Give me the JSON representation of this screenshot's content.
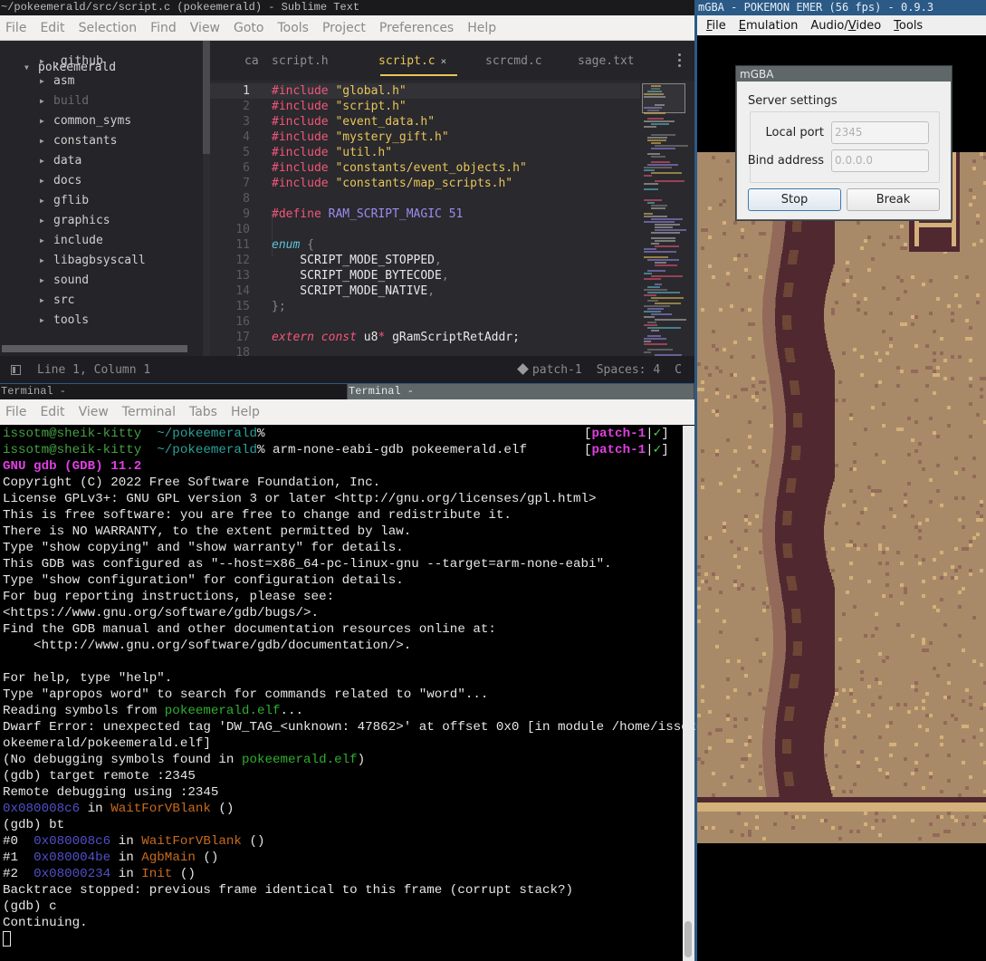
{
  "sublime": {
    "title": "~/pokeemerald/src/script.c (pokeemerald) - Sublime Text",
    "menu": [
      "File",
      "Edit",
      "Selection",
      "Find",
      "View",
      "Goto",
      "Tools",
      "Project",
      "Preferences",
      "Help"
    ],
    "sidebar": {
      "root": "pokeemerald",
      "items": [
        {
          "label": ".github",
          "dim": false
        },
        {
          "label": "asm",
          "dim": false
        },
        {
          "label": "build",
          "dim": true
        },
        {
          "label": "common_syms",
          "dim": false
        },
        {
          "label": "constants",
          "dim": false
        },
        {
          "label": "data",
          "dim": false
        },
        {
          "label": "docs",
          "dim": false
        },
        {
          "label": "gflib",
          "dim": false
        },
        {
          "label": "graphics",
          "dim": false
        },
        {
          "label": "include",
          "dim": false
        },
        {
          "label": "libagbsyscall",
          "dim": false
        },
        {
          "label": "sound",
          "dim": false
        },
        {
          "label": "src",
          "dim": false
        },
        {
          "label": "tools",
          "dim": false
        }
      ]
    },
    "tabs": [
      {
        "label": "ca",
        "active": false
      },
      {
        "label": "script.h",
        "active": false
      },
      {
        "label": "script.c",
        "active": true,
        "close": "×"
      },
      {
        "label": "scrcmd.c",
        "active": false
      },
      {
        "label": "sage.txt",
        "active": false
      }
    ],
    "code": [
      [
        [
          "kw",
          "#include"
        ],
        [
          "pl",
          " "
        ],
        [
          "str",
          "\"global.h\""
        ]
      ],
      [
        [
          "kw",
          "#include"
        ],
        [
          "pl",
          " "
        ],
        [
          "str",
          "\"script.h\""
        ]
      ],
      [
        [
          "kw",
          "#include"
        ],
        [
          "pl",
          " "
        ],
        [
          "str",
          "\"event_data.h\""
        ]
      ],
      [
        [
          "kw",
          "#include"
        ],
        [
          "pl",
          " "
        ],
        [
          "str",
          "\"mystery_gift.h\""
        ]
      ],
      [
        [
          "kw",
          "#include"
        ],
        [
          "pl",
          " "
        ],
        [
          "str",
          "\"util.h\""
        ]
      ],
      [
        [
          "kw",
          "#include"
        ],
        [
          "pl",
          " "
        ],
        [
          "str",
          "\"constants/event_objects.h\""
        ]
      ],
      [
        [
          "kw",
          "#include"
        ],
        [
          "pl",
          " "
        ],
        [
          "str",
          "\"constants/map_scripts.h\""
        ]
      ],
      [],
      [
        [
          "kw",
          "#define"
        ],
        [
          "pl",
          " "
        ],
        [
          "mac",
          "RAM_SCRIPT_MAGIC"
        ],
        [
          "pl",
          " "
        ],
        [
          "num",
          "51"
        ]
      ],
      [],
      [
        [
          "enm",
          "enum"
        ],
        [
          "pl",
          " "
        ],
        [
          "pn",
          "{"
        ]
      ],
      [
        [
          "pl",
          "    SCRIPT_MODE_STOPPED"
        ],
        [
          "pn",
          ","
        ]
      ],
      [
        [
          "pl",
          "    SCRIPT_MODE_BYTECODE"
        ],
        [
          "pn",
          ","
        ]
      ],
      [
        [
          "pl",
          "    SCRIPT_MODE_NATIVE"
        ],
        [
          "pn",
          ","
        ]
      ],
      [
        [
          "pn",
          "};"
        ]
      ],
      [],
      [
        [
          "em",
          "extern"
        ],
        [
          "pl",
          " "
        ],
        [
          "em",
          "const"
        ],
        [
          "pl",
          " u8"
        ],
        [
          "kw",
          "*"
        ],
        [
          "pl",
          " gRamScriptRetAddr;"
        ]
      ]
    ],
    "status": {
      "position": "Line 1, Column 1",
      "branch": "patch-1",
      "indent": "Spaces: 4",
      "syntax": "C"
    }
  },
  "terminal": {
    "tabs": [
      {
        "label": "Terminal -",
        "active": false
      },
      {
        "label": "Terminal -",
        "active": true
      }
    ],
    "menu": [
      "File",
      "Edit",
      "View",
      "Terminal",
      "Tabs",
      "Help"
    ],
    "rprompt": {
      "branch": "patch-1",
      "sep": "|",
      "check": "✓"
    },
    "lines": [
      {
        "segs": [
          [
            "t-user",
            "issotm@sheik-kitty"
          ],
          [
            "",
            "  "
          ],
          [
            "t-cwd",
            "~/pokeemerald"
          ],
          [
            "",
            "%"
          ]
        ],
        "rprompt": true
      },
      {
        "segs": [
          [
            "t-user",
            "issotm@sheik-kitty"
          ],
          [
            "",
            "  "
          ],
          [
            "t-cwd",
            "~/pokeemerald"
          ],
          [
            "",
            "% arm-none-eabi-gdb pokeemerald.elf"
          ]
        ],
        "rprompt": true
      },
      {
        "segs": [
          [
            "t-pink",
            "GNU gdb (GDB) 11.2"
          ]
        ]
      },
      {
        "segs": [
          [
            "",
            "Copyright (C) 2022 Free Software Foundation, Inc."
          ]
        ]
      },
      {
        "segs": [
          [
            "",
            "License GPLv3+: GNU GPL version 3 or later <http://gnu.org/licenses/gpl.html>"
          ]
        ]
      },
      {
        "segs": [
          [
            "",
            "This is free software: you are free to change and redistribute it."
          ]
        ]
      },
      {
        "segs": [
          [
            "",
            "There is NO WARRANTY, to the extent permitted by law."
          ]
        ]
      },
      {
        "segs": [
          [
            "",
            "Type \"show copying\" and \"show warranty\" for details."
          ]
        ]
      },
      {
        "segs": [
          [
            "",
            "This GDB was configured as \"--host=x86_64-pc-linux-gnu --target=arm-none-eabi\"."
          ]
        ]
      },
      {
        "segs": [
          [
            "",
            "Type \"show configuration\" for configuration details."
          ]
        ]
      },
      {
        "segs": [
          [
            "",
            "For bug reporting instructions, please see:"
          ]
        ]
      },
      {
        "segs": [
          [
            "",
            "<https://www.gnu.org/software/gdb/bugs/>."
          ]
        ]
      },
      {
        "segs": [
          [
            "",
            "Find the GDB manual and other documentation resources online at:"
          ]
        ]
      },
      {
        "segs": [
          [
            "",
            "    <http://www.gnu.org/software/gdb/documentation/>."
          ]
        ]
      },
      {
        "segs": [
          [
            "",
            ""
          ]
        ]
      },
      {
        "segs": [
          [
            "",
            "For help, type \"help\"."
          ]
        ]
      },
      {
        "segs": [
          [
            "",
            "Type \"apropos word\" to search for commands related to \"word\"..."
          ]
        ]
      },
      {
        "segs": [
          [
            "",
            "Reading symbols from "
          ],
          [
            "t-green",
            "pokeemerald.elf"
          ],
          [
            "",
            "..."
          ]
        ]
      },
      {
        "segs": [
          [
            "",
            "Dwarf Error: unexpected tag 'DW_TAG_<unknown: 47862>' at offset 0x0 [in module /home/issotm/p"
          ]
        ]
      },
      {
        "segs": [
          [
            "",
            "okeemerald/pokeemerald.elf]"
          ]
        ]
      },
      {
        "segs": [
          [
            "",
            "(No debugging symbols found in "
          ],
          [
            "t-green",
            "pokeemerald.elf"
          ],
          [
            "",
            ")"
          ]
        ]
      },
      {
        "segs": [
          [
            "",
            "(gdb) target remote :2345"
          ]
        ]
      },
      {
        "segs": [
          [
            "",
            "Remote debugging using :2345"
          ]
        ]
      },
      {
        "segs": [
          [
            "t-addr",
            "0x080008c6"
          ],
          [
            "",
            " in "
          ],
          [
            "t-func",
            "WaitForVBlank"
          ],
          [
            "",
            " ()"
          ]
        ]
      },
      {
        "segs": [
          [
            "",
            "(gdb) bt"
          ]
        ]
      },
      {
        "segs": [
          [
            "",
            "#0  "
          ],
          [
            "t-addr",
            "0x080008c6"
          ],
          [
            "",
            " in "
          ],
          [
            "t-func",
            "WaitForVBlank"
          ],
          [
            "",
            " ()"
          ]
        ]
      },
      {
        "segs": [
          [
            "",
            "#1  "
          ],
          [
            "t-addr",
            "0x080004be"
          ],
          [
            "",
            " in "
          ],
          [
            "t-func",
            "AgbMain"
          ],
          [
            "",
            " ()"
          ]
        ]
      },
      {
        "segs": [
          [
            "",
            "#2  "
          ],
          [
            "t-addr",
            "0x08000234"
          ],
          [
            "",
            " in "
          ],
          [
            "t-func",
            "Init"
          ],
          [
            "",
            " ()"
          ]
        ]
      },
      {
        "segs": [
          [
            "",
            "Backtrace stopped: previous frame identical to this frame (corrupt stack?)"
          ]
        ]
      },
      {
        "segs": [
          [
            "",
            "(gdb) c"
          ]
        ]
      },
      {
        "segs": [
          [
            "",
            "Continuing."
          ]
        ]
      }
    ]
  },
  "mgba": {
    "title": "mGBA - POKEMON EMER (56 fps) - 0.9.3",
    "menu": [
      {
        "first": "F",
        "rest": "ile"
      },
      {
        "first": "E",
        "rest": "mulation"
      },
      {
        "pre": "Audio/",
        "first": "V",
        "rest": "ideo"
      },
      {
        "first": "T",
        "rest": "ools"
      }
    ],
    "dialog": {
      "title": "mGBA",
      "group_label": "Server settings",
      "local_port_label": "Local port",
      "local_port_value": "2345",
      "bind_address_label": "Bind address",
      "bind_address_value": "0.0.0.0",
      "stop_label": "Stop",
      "break_label": "Break"
    },
    "palette": {
      "sand": "#a98a68",
      "sand_light": "#d4b07a",
      "sand_mid": "#93695a",
      "crack_dark": "#4f2830",
      "crack_mid": "#6e4636"
    }
  }
}
